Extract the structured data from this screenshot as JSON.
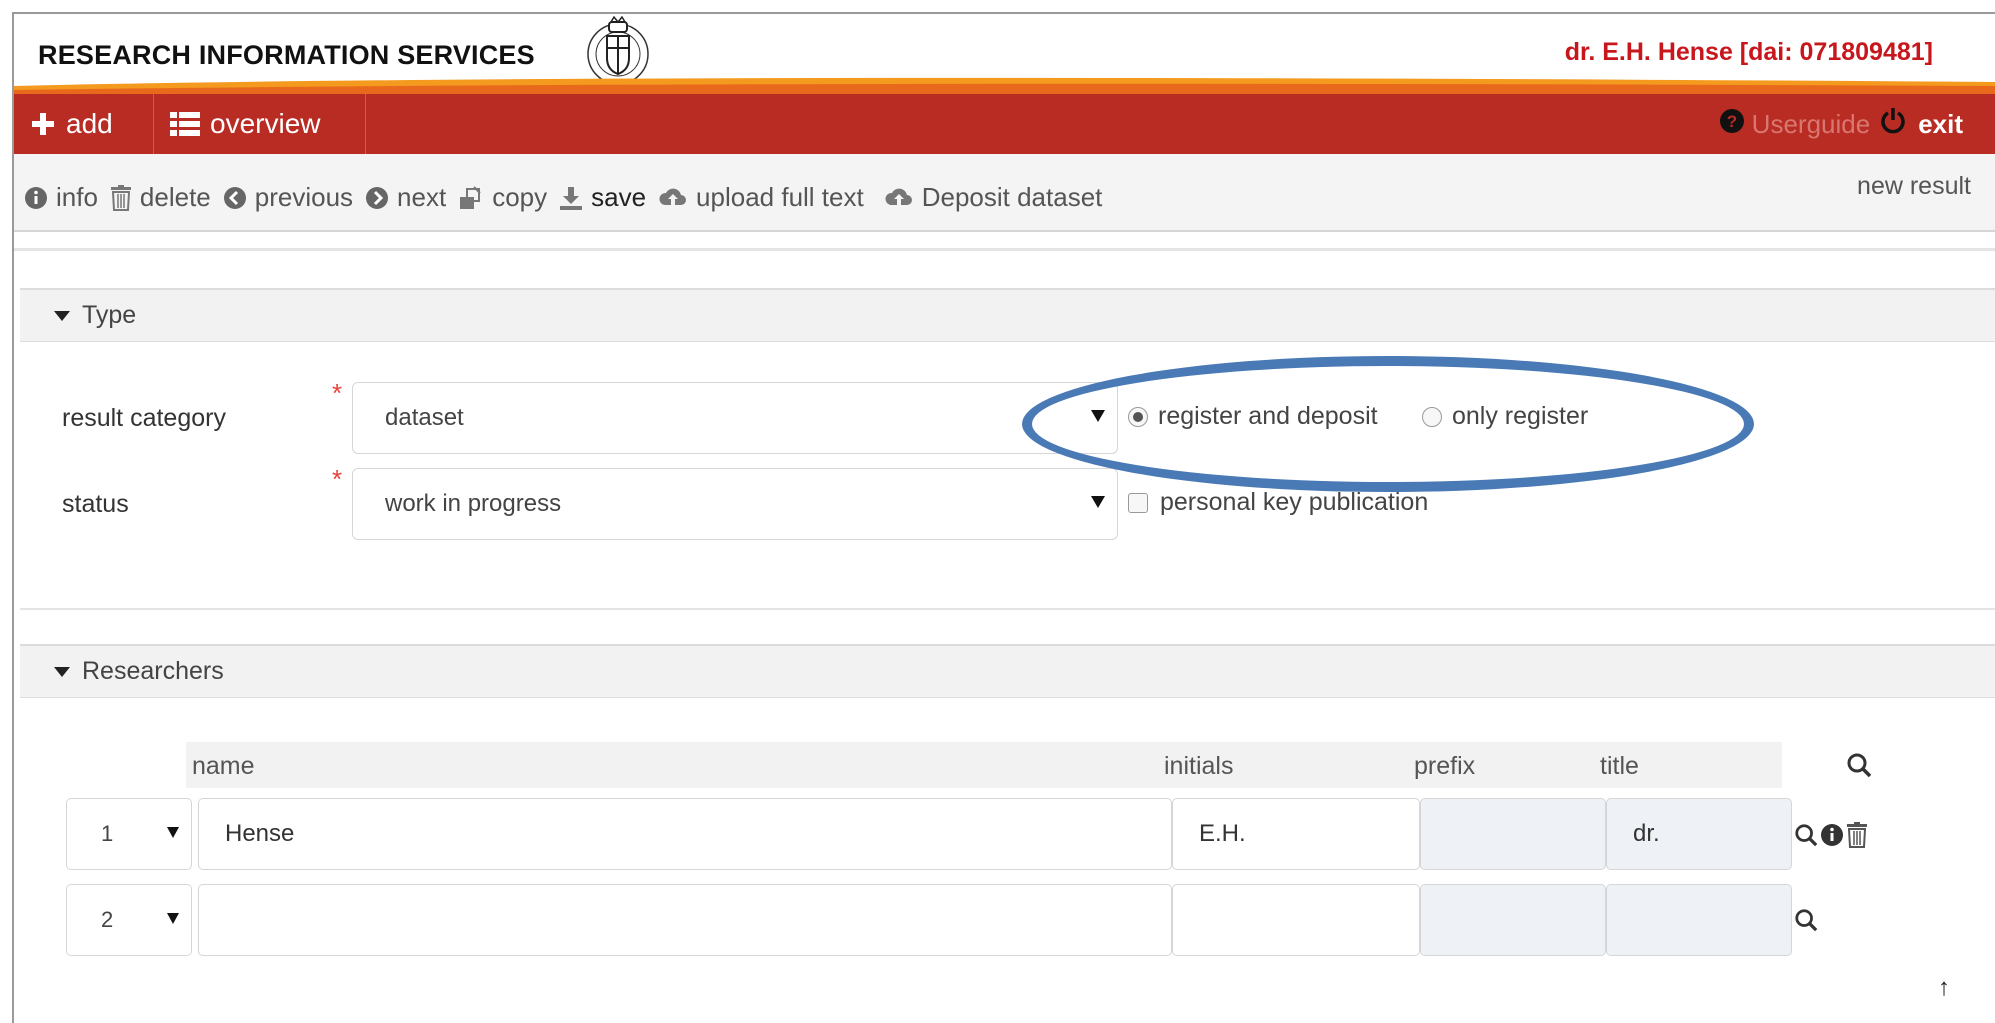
{
  "header": {
    "brand": "RESEARCH INFORMATION SERVICES",
    "user": "dr. E.H. Hense [dai: 071809481]"
  },
  "navbar": {
    "add_label": "add",
    "overview_label": "overview",
    "userguide_label": "Userguide",
    "exit_label": "exit"
  },
  "toolbar": {
    "items": [
      {
        "label": "info",
        "icon": "info-circle-icon"
      },
      {
        "label": "delete",
        "icon": "trash-icon"
      },
      {
        "label": "previous",
        "icon": "arrow-left-circle-icon"
      },
      {
        "label": "next",
        "icon": "arrow-right-circle-icon"
      },
      {
        "label": "copy",
        "icon": "copy-icon"
      },
      {
        "label": "save",
        "icon": "download-icon"
      },
      {
        "label": "upload full text",
        "icon": "cloud-upload-icon"
      },
      {
        "label": "Deposit dataset",
        "icon": "cloud-upload-icon"
      }
    ],
    "new_result": "new result"
  },
  "type_panel": {
    "title": "Type",
    "result_category_label": "result category",
    "result_category_value": "dataset",
    "status_label": "status",
    "status_value": "work in progress",
    "radio_register_deposit": "register and deposit",
    "radio_only_register": "only register",
    "selected_radio": "register and deposit",
    "personal_key_label": "personal key publication",
    "personal_key_checked": false
  },
  "researchers_panel": {
    "title": "Researchers",
    "columns": [
      "name",
      "initials",
      "prefix",
      "title"
    ],
    "rows": [
      {
        "index": "1",
        "name": "Hense",
        "initials": "E.H.",
        "prefix": "",
        "title": "dr."
      },
      {
        "index": "2",
        "name": "",
        "initials": "",
        "prefix": "",
        "title": ""
      }
    ]
  },
  "colors": {
    "navbar": "#b82c24",
    "user_name": "#c8161d",
    "highlight_oval": "#4a7ab5",
    "required_star": "#e8413a"
  }
}
